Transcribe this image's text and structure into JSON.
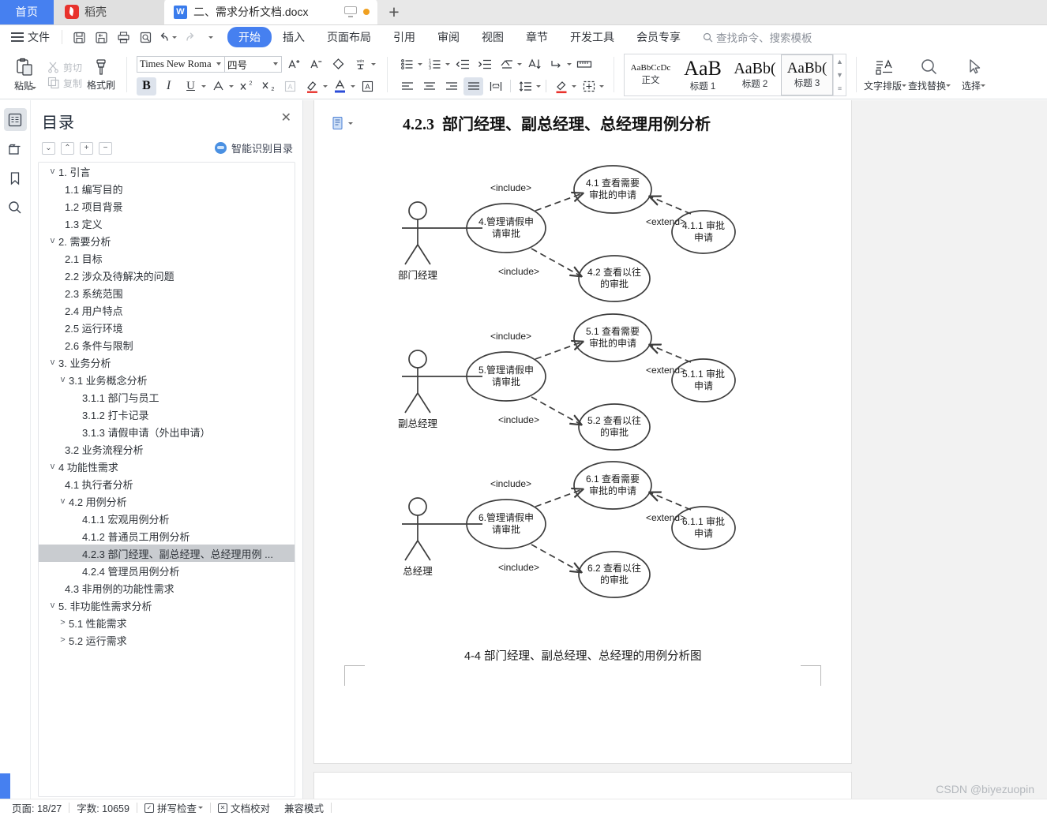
{
  "tabbar": {
    "home_label": "首页",
    "daoke_label": "稻壳",
    "doc_title": "二、需求分析文档.docx",
    "new_tab_label": "+"
  },
  "menubar": {
    "file_label": "文件",
    "quick_icons": [
      "save-icon",
      "save-as-icon",
      "print-icon",
      "print-preview-icon",
      "undo-icon",
      "redo-icon",
      "customize-icon"
    ],
    "items": [
      {
        "label": "开始",
        "active": true
      },
      {
        "label": "插入",
        "active": false
      },
      {
        "label": "页面布局",
        "active": false
      },
      {
        "label": "引用",
        "active": false
      },
      {
        "label": "审阅",
        "active": false
      },
      {
        "label": "视图",
        "active": false
      },
      {
        "label": "章节",
        "active": false
      },
      {
        "label": "开发工具",
        "active": false
      },
      {
        "label": "会员专享",
        "active": false
      }
    ],
    "search_placeholder": "查找命令、搜索模板"
  },
  "ribbon": {
    "paste_label": "粘贴",
    "cut_label": "剪切",
    "copy_label": "复制",
    "format_painter_label": "格式刷",
    "font_name": "Times New Roma",
    "font_size": "四号",
    "font_tools": [
      "grow-font-icon",
      "shrink-font-icon",
      "clear-format-icon",
      "pinyin-guide-icon"
    ],
    "font_tools_row2": [
      "bold-icon",
      "italic-icon",
      "underline-icon",
      "strikethrough-icon",
      "superscript-icon",
      "subscript-icon",
      "char-border-icon",
      "highlight-icon",
      "font-color-icon",
      "char-shading-icon"
    ],
    "para_tools_row1": [
      "bullet-list-icon",
      "numbered-list-icon",
      "decrease-indent-icon",
      "increase-indent-icon",
      "multilevel-list-icon",
      "sort-icon",
      "show-marks-icon",
      "ruler-icon"
    ],
    "para_tools_row2": [
      "align-left-icon",
      "align-center-icon",
      "align-right-icon",
      "justify-icon",
      "distributed-icon",
      "line-spacing-icon",
      "shading-icon",
      "borders-icon"
    ],
    "styles": [
      {
        "preview": "AaBbCcDc",
        "name": "正文",
        "size": 11,
        "selected": false
      },
      {
        "preview": "AaB",
        "name": "标题 1",
        "size": 26,
        "selected": false
      },
      {
        "preview": "AaBb(",
        "name": "标题 2",
        "size": 20,
        "selected": false
      },
      {
        "preview": "AaBb(",
        "name": "标题 3",
        "size": 18,
        "selected": true
      }
    ],
    "text_layout_label": "文字排版",
    "find_replace_label": "查找替换",
    "select_label": "选择"
  },
  "rail": {
    "items": [
      "outline-panel-icon",
      "thumbnail-panel-icon",
      "bookmark-panel-icon",
      "search-panel-icon"
    ]
  },
  "nav": {
    "title": "目录",
    "close_label": "✕",
    "tools": [
      "collapse-down-icon",
      "collapse-up-icon",
      "expand-all-icon",
      "collapse-all-icon"
    ],
    "smart_label": "智能识别目录",
    "items": [
      {
        "text": "1. 引言",
        "level": 1,
        "twisty": "v",
        "selected": false
      },
      {
        "text": "1.1 编写目的",
        "level": 2,
        "twisty": "",
        "selected": false
      },
      {
        "text": "1.2 项目背景",
        "level": 2,
        "twisty": "",
        "selected": false
      },
      {
        "text": "1.3 定义",
        "level": 2,
        "twisty": "",
        "selected": false
      },
      {
        "text": "2. 需要分析",
        "level": 1,
        "twisty": "v",
        "selected": false
      },
      {
        "text": "2.1 目标",
        "level": 2,
        "twisty": "",
        "selected": false
      },
      {
        "text": "2.2 涉众及待解决的问题",
        "level": 2,
        "twisty": "",
        "selected": false
      },
      {
        "text": "2.3 系统范围",
        "level": 2,
        "twisty": "",
        "selected": false
      },
      {
        "text": "2.4 用户特点",
        "level": 2,
        "twisty": "",
        "selected": false
      },
      {
        "text": "2.5 运行环境",
        "level": 2,
        "twisty": "",
        "selected": false
      },
      {
        "text": "2.6 条件与限制",
        "level": 2,
        "twisty": "",
        "selected": false
      },
      {
        "text": "3. 业务分析",
        "level": 1,
        "twisty": "v",
        "selected": false
      },
      {
        "text": "3.1 业务概念分析",
        "level": 2,
        "twisty": "v",
        "selected": false
      },
      {
        "text": "3.1.1 部门与员工",
        "level": 3,
        "twisty": "",
        "selected": false
      },
      {
        "text": "3.1.2 打卡记录",
        "level": 3,
        "twisty": "",
        "selected": false
      },
      {
        "text": "3.1.3 请假申请（外出申请）",
        "level": 3,
        "twisty": "",
        "selected": false
      },
      {
        "text": "3.2 业务流程分析",
        "level": 2,
        "twisty": "",
        "selected": false
      },
      {
        "text": "4 功能性需求",
        "level": 1,
        "twisty": "v",
        "selected": false
      },
      {
        "text": "4.1 执行者分析",
        "level": 2,
        "twisty": "",
        "selected": false
      },
      {
        "text": "4.2 用例分析",
        "level": 2,
        "twisty": "v",
        "selected": false
      },
      {
        "text": "4.1.1 宏观用例分析",
        "level": 3,
        "twisty": "",
        "selected": false
      },
      {
        "text": "4.1.2 普通员工用例分析",
        "level": 3,
        "twisty": "",
        "selected": false
      },
      {
        "text": "4.2.3 部门经理、副总经理、总经理用例 ...",
        "level": 3,
        "twisty": "",
        "selected": true
      },
      {
        "text": "4.2.4 管理员用例分析",
        "level": 3,
        "twisty": "",
        "selected": false
      },
      {
        "text": "4.3 非用例的功能性需求",
        "level": 2,
        "twisty": "",
        "selected": false
      },
      {
        "text": "5. 非功能性需求分析",
        "level": 1,
        "twisty": "v",
        "selected": false
      },
      {
        "text": "5.1 性能需求",
        "level": 2,
        "twisty": ">",
        "selected": false
      },
      {
        "text": "5.2 运行需求",
        "level": 2,
        "twisty": ">",
        "selected": false
      }
    ]
  },
  "document": {
    "heading_number": "4.2.3",
    "heading_text": "部门经理、副总经理、总经理用例分析",
    "caption": "4-4 部门经理、副总经理、总经理的用例分析图",
    "diagram": {
      "type": "uml-use-case",
      "include_label": "<include>",
      "extend_label": "<extend>",
      "groups": [
        {
          "actor": "部门经理",
          "main": "4.管理请假申\n请审批",
          "uc_top": "4.1 查看需要\n审批的申请",
          "uc_bottom": "4.2 查看以往\n的审批",
          "uc_extend": "4.1.1 审批\n申请"
        },
        {
          "actor": "副总经理",
          "main": "5.管理请假申\n请审批",
          "uc_top": "5.1 查看需要\n审批的申请",
          "uc_bottom": "5.2 查看以往\n的审批",
          "uc_extend": "5.1.1 审批\n申请"
        },
        {
          "actor": "总经理",
          "main": "6.管理请假申\n请审批",
          "uc_top": "6.1 查看需要\n审批的申请",
          "uc_bottom": "6.2 查看以往\n的审批",
          "uc_extend": "6.1.1 审批\n申请"
        }
      ]
    }
  },
  "statusbar": {
    "page_label": "页面: 18/27",
    "words_label": "字数: 10659",
    "spellcheck_label": "拼写检查",
    "proofread_label": "文档校对",
    "compat_label": "兼容模式"
  },
  "watermark": "CSDN @biyezuopin",
  "colors": {
    "accent": "#4680f0",
    "tab_home_bg": "#4680f0",
    "selection_bg": "#c9ccd0",
    "page_bg": "#f2f2f2"
  }
}
